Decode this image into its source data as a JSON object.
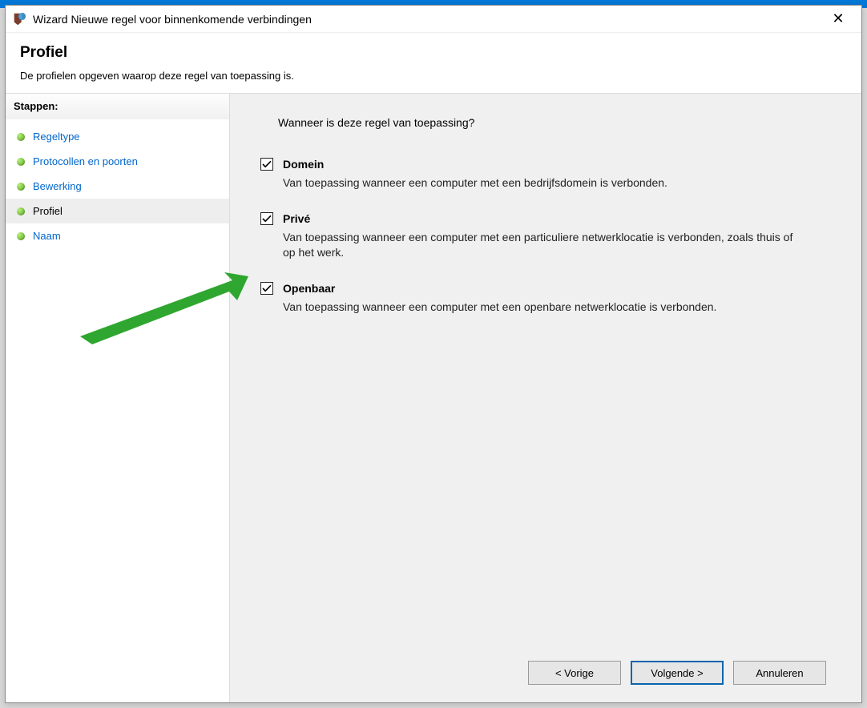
{
  "window": {
    "title": "Wizard Nieuwe regel voor binnenkomende verbindingen"
  },
  "header": {
    "heading": "Profiel",
    "subtitle": "De profielen opgeven waarop deze regel van toepassing is."
  },
  "sidebar": {
    "heading": "Stappen:",
    "items": [
      {
        "label": "Regeltype",
        "current": false
      },
      {
        "label": "Protocollen en poorten",
        "current": false
      },
      {
        "label": "Bewerking",
        "current": false
      },
      {
        "label": "Profiel",
        "current": true
      },
      {
        "label": "Naam",
        "current": false
      }
    ]
  },
  "content": {
    "question": "Wanneer is deze regel van toepassing?",
    "options": [
      {
        "key": "domein",
        "title": "Domein",
        "checked": true,
        "description": "Van toepassing wanneer een computer met een bedrijfsdomein is verbonden."
      },
      {
        "key": "prive",
        "title": "Privé",
        "checked": true,
        "description": "Van toepassing wanneer een computer met een particuliere netwerklocatie is verbonden, zoals thuis of op het werk."
      },
      {
        "key": "openbaar",
        "title": "Openbaar",
        "checked": true,
        "description": "Van toepassing wanneer een computer met een openbare netwerklocatie is verbonden."
      }
    ]
  },
  "footer": {
    "back": "< Vorige",
    "next": "Volgende >",
    "cancel": "Annuleren"
  }
}
